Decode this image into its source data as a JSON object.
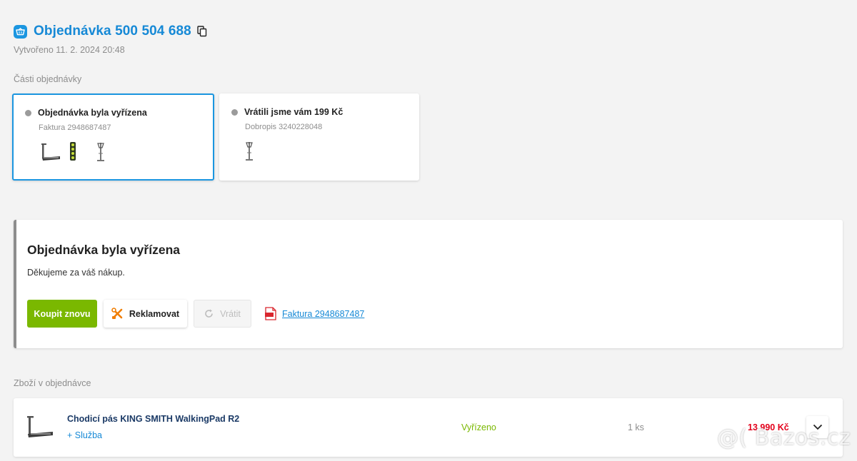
{
  "header": {
    "title": "Objednávka 500 504 688",
    "created": "Vytvořeno 11. 2. 2024 20:48",
    "accent_color": "#1b96e0"
  },
  "parts": {
    "label": "Části objednávky",
    "cards": [
      {
        "title": "Objednávka byla vyřízena",
        "subtitle": "Faktura 2948687487",
        "selected": true,
        "thumbs": [
          "treadmill-thumb",
          "lamp-thumb",
          "stand-thumb"
        ]
      },
      {
        "title": "Vrátili jsme vám 199 Kč",
        "subtitle": "Dobropis 3240228048",
        "selected": false,
        "thumbs": [
          "stand-thumb"
        ]
      }
    ]
  },
  "status_panel": {
    "title": "Objednávka byla vyřízena",
    "text": "Děkujeme za váš nákup.",
    "buy_again_label": "Koupit znovu",
    "claim_label": "Reklamovat",
    "return_label": "Vrátit",
    "invoice_link": "Faktura 2948687487",
    "buy_color": "#7ab800"
  },
  "items": {
    "label": "Zboží v objednávce",
    "rows": [
      {
        "name": "Chodicí pás KING SMITH WalkingPad R2",
        "service": "+ Služba",
        "status": "Vyřízeno",
        "qty": "1 ks",
        "price": "13 990 Kč"
      }
    ]
  },
  "watermark": "@( Bazos.cz"
}
